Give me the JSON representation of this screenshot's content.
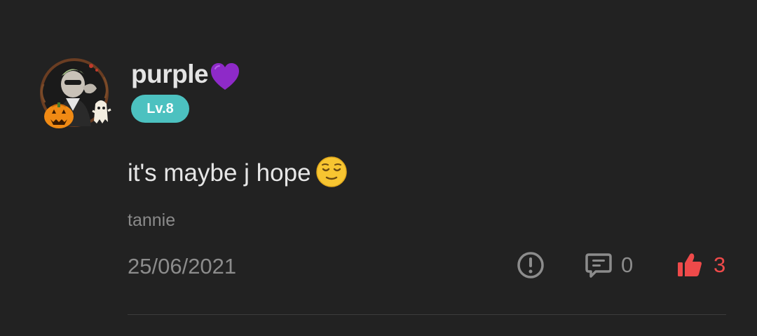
{
  "comment": {
    "user": {
      "name": "purple",
      "name_emoji": "purple-heart-icon",
      "level": "Lv.8",
      "avatar": "avatar-with-halloween-frame"
    },
    "text": "it's maybe j hope",
    "text_emoji": "relieved-face-icon",
    "tag": "tannie",
    "date": "25/06/2021",
    "actions": {
      "report_icon": "exclamation-circle-icon",
      "reply_icon": "comment-bubble-icon",
      "reply_count": "0",
      "like_icon": "thumbs-up-icon",
      "like_count": "3"
    }
  },
  "colors": {
    "background": "#222222",
    "level_badge": "#4cc1c0",
    "like_active": "#ee4a4a",
    "muted_text": "#8c8c8c"
  }
}
